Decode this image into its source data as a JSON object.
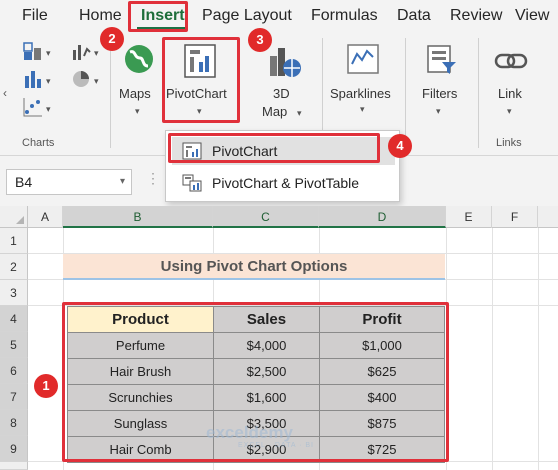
{
  "menu": {
    "tabs": [
      "File",
      "Home",
      "Insert",
      "Page Layout",
      "Formulas",
      "Data",
      "Review",
      "View"
    ],
    "active_tab": "Insert"
  },
  "ribbon": {
    "maps_label": "Maps",
    "pivotchart_label": "PivotChart",
    "map3d_line1": "3D",
    "map3d_line2": "Map",
    "sparklines_label": "Sparklines",
    "filters_label": "Filters",
    "link_label": "Link",
    "group_charts": "Charts",
    "group_links": "Links"
  },
  "dropdown": {
    "item1": "PivotChart",
    "item2": "PivotChart & PivotTable"
  },
  "formula_bar": {
    "name_box": "B4",
    "separator": "⋮"
  },
  "grid": {
    "columns": [
      "A",
      "B",
      "C",
      "D",
      "E",
      "F"
    ],
    "rows": [
      "1",
      "2",
      "3",
      "4",
      "5",
      "6",
      "7",
      "8",
      "9"
    ],
    "title": "Using Pivot Chart Options"
  },
  "table": {
    "headers": [
      "Product",
      "Sales",
      "Profit"
    ],
    "rows": [
      [
        "Perfume",
        "$4,000",
        "$1,000"
      ],
      [
        "Hair Brush",
        "$2,500",
        "$625"
      ],
      [
        "Scrunchies",
        "$1,600",
        "$400"
      ],
      [
        "Sunglass",
        "$3,500",
        "$875"
      ],
      [
        "Hair Comb",
        "$2,900",
        "$725"
      ]
    ]
  },
  "callouts": [
    "1",
    "2",
    "3",
    "4"
  ],
  "watermark": {
    "brand": "exceldemy",
    "tagline": "EXCEL · DATA · BI"
  },
  "colors": {
    "accent_green": "#217346",
    "callout_red": "#e0303a",
    "header_fill": "#fff2cc",
    "body_fill": "#d0cece",
    "title_fill": "#fbe4d5"
  }
}
